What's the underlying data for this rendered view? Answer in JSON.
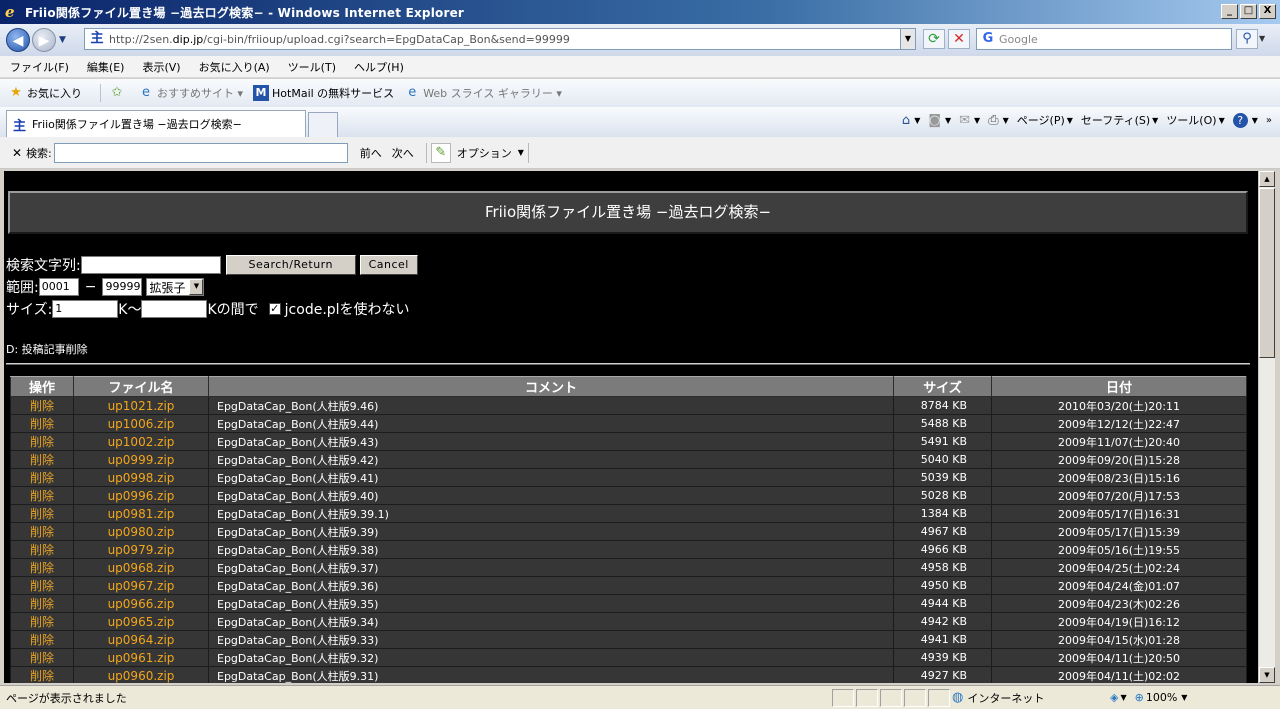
{
  "window": {
    "title": "Friio関係ファイル置き場 −過去ログ検索− - Windows Internet Explorer",
    "controls": [
      "_",
      "□",
      "X"
    ]
  },
  "address_bar": {
    "url_prefix": "http://2sen.",
    "url_domain": "dip.jp",
    "url_suffix": "/cgi-bin/friioup/upload.cgi?search=EpgDataCap_Bon&send=99999",
    "search_placeholder": "Google"
  },
  "menu": [
    "ファイル(F)",
    "編集(E)",
    "表示(V)",
    "お気に入り(A)",
    "ツール(T)",
    "ヘルプ(H)"
  ],
  "favorites": {
    "favorites_label": "お気に入り",
    "items": [
      "おすすめサイト ▾",
      "HotMail の無料サービス",
      "Web スライス ギャラリー ▾"
    ]
  },
  "tab": {
    "title": "Friio関係ファイル置き場 −過去ログ検索−"
  },
  "command_bar": {
    "page": "ページ(P)",
    "safety": "セーフティ(S)",
    "tools": "ツール(O)"
  },
  "find_bar": {
    "label": "検索:",
    "prev": "前へ",
    "next": "次へ",
    "options": "オプション"
  },
  "page": {
    "heading": "Friio関係ファイル置き場 −過去ログ検索−",
    "search_label": "検索文字列:",
    "search_button": "Search/Return",
    "cancel_button": "Cancel",
    "range_label": "範囲:",
    "range_from": "0001",
    "range_sep": "−",
    "range_to": "99999",
    "ext_select": "拡張子",
    "size_label": "サイズ:",
    "size_from": "1",
    "size_mid": "K〜",
    "size_suffix": "Kの間で",
    "jcode_label": "jcode.plを使わない",
    "note": "D: 投稿記事削除"
  },
  "table": {
    "headers": [
      "操作",
      "ファイル名",
      "コメント",
      "サイズ",
      "日付"
    ],
    "rows": [
      {
        "op": "削除",
        "file": "up1021.zip",
        "comment": "EpgDataCap_Bon(人柱版9.46)",
        "size": "8784 KB",
        "date": "2010年03/20(土)20:11"
      },
      {
        "op": "削除",
        "file": "up1006.zip",
        "comment": "EpgDataCap_Bon(人柱版9.44)",
        "size": "5488 KB",
        "date": "2009年12/12(土)22:47"
      },
      {
        "op": "削除",
        "file": "up1002.zip",
        "comment": "EpgDataCap_Bon(人柱版9.43)",
        "size": "5491 KB",
        "date": "2009年11/07(土)20:40"
      },
      {
        "op": "削除",
        "file": "up0999.zip",
        "comment": "EpgDataCap_Bon(人柱版9.42)",
        "size": "5040 KB",
        "date": "2009年09/20(日)15:28"
      },
      {
        "op": "削除",
        "file": "up0998.zip",
        "comment": "EpgDataCap_Bon(人柱版9.41)",
        "size": "5039 KB",
        "date": "2009年08/23(日)15:16"
      },
      {
        "op": "削除",
        "file": "up0996.zip",
        "comment": "EpgDataCap_Bon(人柱版9.40)",
        "size": "5028 KB",
        "date": "2009年07/20(月)17:53"
      },
      {
        "op": "削除",
        "file": "up0981.zip",
        "comment": "EpgDataCap_Bon(人柱版9.39.1)",
        "size": "1384 KB",
        "date": "2009年05/17(日)16:31"
      },
      {
        "op": "削除",
        "file": "up0980.zip",
        "comment": "EpgDataCap_Bon(人柱版9.39)",
        "size": "4967 KB",
        "date": "2009年05/17(日)15:39"
      },
      {
        "op": "削除",
        "file": "up0979.zip",
        "comment": "EpgDataCap_Bon(人柱版9.38)",
        "size": "4966 KB",
        "date": "2009年05/16(土)19:55"
      },
      {
        "op": "削除",
        "file": "up0968.zip",
        "comment": "EpgDataCap_Bon(人柱版9.37)",
        "size": "4958 KB",
        "date": "2009年04/25(土)02:24"
      },
      {
        "op": "削除",
        "file": "up0967.zip",
        "comment": "EpgDataCap_Bon(人柱版9.36)",
        "size": "4950 KB",
        "date": "2009年04/24(金)01:07"
      },
      {
        "op": "削除",
        "file": "up0966.zip",
        "comment": "EpgDataCap_Bon(人柱版9.35)",
        "size": "4944 KB",
        "date": "2009年04/23(木)02:26"
      },
      {
        "op": "削除",
        "file": "up0965.zip",
        "comment": "EpgDataCap_Bon(人柱版9.34)",
        "size": "4942 KB",
        "date": "2009年04/19(日)16:12"
      },
      {
        "op": "削除",
        "file": "up0964.zip",
        "comment": "EpgDataCap_Bon(人柱版9.33)",
        "size": "4941 KB",
        "date": "2009年04/15(水)01:28"
      },
      {
        "op": "削除",
        "file": "up0961.zip",
        "comment": "EpgDataCap_Bon(人柱版9.32)",
        "size": "4939 KB",
        "date": "2009年04/11(土)20:50"
      },
      {
        "op": "削除",
        "file": "up0960.zip",
        "comment": "EpgDataCap_Bon(人柱版9.31)",
        "size": "4927 KB",
        "date": "2009年04/11(土)02:02"
      }
    ]
  },
  "status": {
    "text": "ページが表示されました",
    "zone": "インターネット",
    "zoom": "100%"
  }
}
